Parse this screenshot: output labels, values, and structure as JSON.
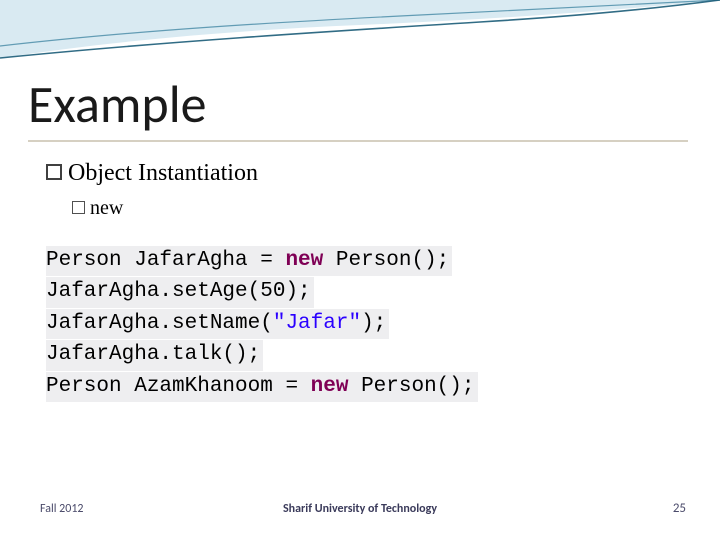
{
  "title": "Example",
  "bullet_main": "Object Instantiation",
  "bullet_sub": "new",
  "code": {
    "l1_a": "Person JafarAgha = ",
    "l1_kw": "new",
    "l1_b": " Person();",
    "l2": "JafarAgha.setAge(50);",
    "l3_a": "JafarAgha.setName(",
    "l3_str": "\"Jafar\"",
    "l3_b": ");",
    "l4": "JafarAgha.talk();",
    "l5_a": "Person AzamKhanoom = ",
    "l5_kw": "new",
    "l5_b": " Person();"
  },
  "footer": {
    "left": "Fall 2012",
    "center": "Sharif University of Technology",
    "page": "25"
  }
}
